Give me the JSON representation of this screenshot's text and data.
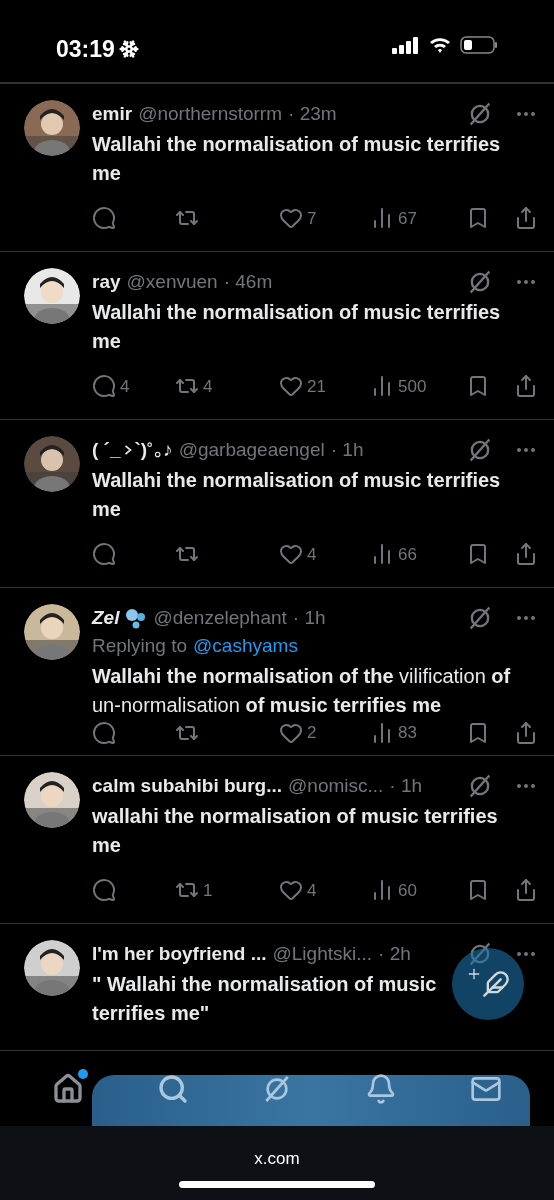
{
  "status_bar": {
    "time": "03:19"
  },
  "tweets": [
    {
      "name": "emir",
      "name_italic": false,
      "badge": false,
      "handle": "@northernstorrm",
      "time": "· 23m",
      "body": "**Wallahi the normalisation of music terrifies me**",
      "counts": {
        "like": "7",
        "views": "67"
      }
    },
    {
      "name": "ray",
      "name_italic": false,
      "badge": false,
      "handle": "@xenvuen",
      "time": "· 46m",
      "body": "**Wallahi the normalisation of music terrifies me**",
      "counts": {
        "reply": "4",
        "repost": "4",
        "like": "21",
        "views": "500"
      }
    },
    {
      "name": "( ´_",
      "kaomoji_rest": "`)",
      "kaomoji_end": "♪",
      "name_italic": false,
      "badge": false,
      "handle": "@garbageaengel",
      "time": "· 1h",
      "body": "**Wallahi the normalisation of music terrifies me**",
      "counts": {
        "like": "4",
        "views": "66"
      }
    },
    {
      "name": "Zel",
      "name_italic": true,
      "badge": true,
      "handle": "@denzelephant",
      "time": "· 1h",
      "replying_label": "Replying to",
      "replying_to": "@cashyams",
      "body": "**Wallahi the normalisation of the** vilification **of** un-normalisation **of music terrifies me**",
      "counts": {
        "like": "2",
        "views": "83"
      }
    },
    {
      "name": "calm subahibi burg...",
      "name_italic": false,
      "badge": false,
      "handle": "@nomisc...",
      "time": "· 1h",
      "body": "**wallahi the normalisation of music terrifies me**",
      "counts": {
        "repost": "1",
        "like": "4",
        "views": "60"
      }
    },
    {
      "name": "I'm her boyfriend ...",
      "name_italic": false,
      "badge": false,
      "handle": "@Lightski...",
      "time": "· 2h",
      "body": "**\" Wallahi the normalisation of music terrifies me\"**"
    }
  ],
  "nav": {
    "home_selected": true,
    "home_dot": true
  },
  "browser": {
    "url": "x.com"
  }
}
